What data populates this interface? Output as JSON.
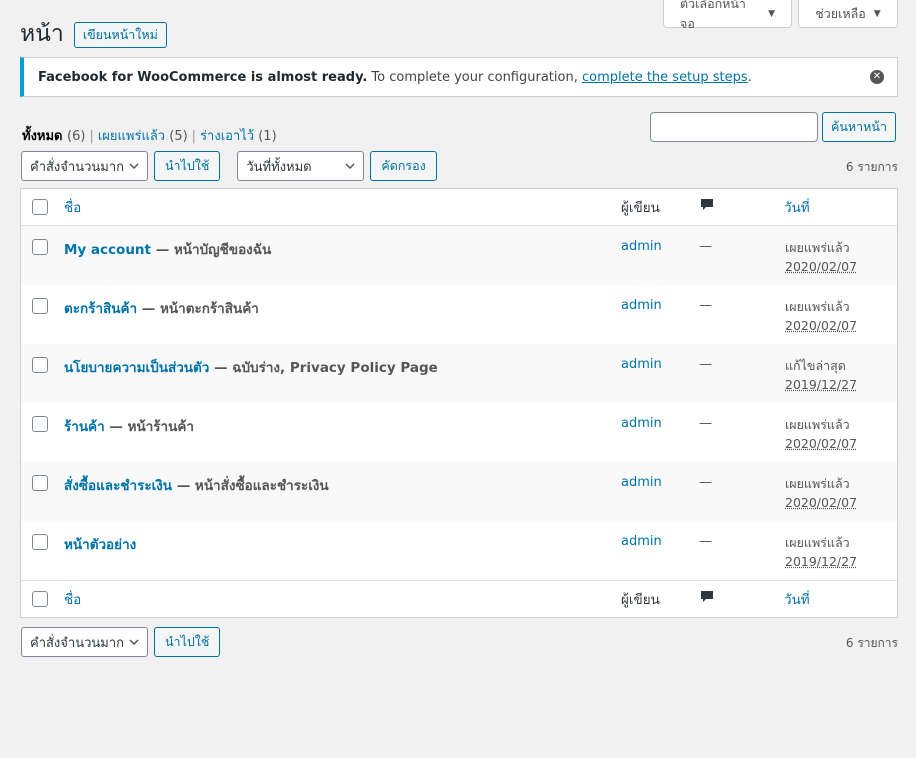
{
  "screen_options": {
    "label": "ตัวเลือกหน้าจอ"
  },
  "help": {
    "label": "ช่วยเหลือ"
  },
  "page": {
    "title": "หน้า",
    "add_new": "เขียนหน้าใหม่"
  },
  "notice": {
    "bold": "Facebook for WooCommerce is almost ready.",
    "text": " To complete your configuration, ",
    "link": "complete the setup steps",
    "end": "."
  },
  "views": [
    {
      "label": "ทั้งหมด",
      "count": "(6)"
    },
    {
      "label": "เผยแพร่แล้ว",
      "count": "(5)"
    },
    {
      "label": "ร่างเอาไว้",
      "count": "(1)"
    }
  ],
  "search": {
    "button": "ค้นหาหน้า",
    "value": ""
  },
  "bulk": {
    "selected": "คำสั่งจำนวนมาก",
    "apply": "นำไปใช้"
  },
  "dates": {
    "selected": "วันที่ทั้งหมด",
    "filter": "คัดกรอง"
  },
  "count_label": "6 รายการ",
  "columns": {
    "title": "ชื่อ",
    "author": "ผู้เขียน",
    "date": "วันที่"
  },
  "rows": [
    {
      "title": "My account",
      "state": " — หน้าบัญชีของฉัน",
      "author": "admin",
      "comments": "—",
      "status": "เผยแพร่แล้ว",
      "date": "2020/02/07"
    },
    {
      "title": "ตะกร้าสินค้า",
      "state": " — หน้าตะกร้าสินค้า",
      "author": "admin",
      "comments": "—",
      "status": "เผยแพร่แล้ว",
      "date": "2020/02/07"
    },
    {
      "title": "นโยบายความเป็นส่วนตัว",
      "state": " — ฉบับร่าง, Privacy Policy Page",
      "author": "admin",
      "comments": "—",
      "status": "แก้ไขล่าสุด",
      "date": "2019/12/27"
    },
    {
      "title": "ร้านค้า",
      "state": " — หน้าร้านค้า",
      "author": "admin",
      "comments": "—",
      "status": "เผยแพร่แล้ว",
      "date": "2020/02/07"
    },
    {
      "title": "สั่งซื้อและชำระเงิน",
      "state": " — หน้าสั่งซื้อและชำระเงิน",
      "author": "admin",
      "comments": "—",
      "status": "เผยแพร่แล้ว",
      "date": "2020/02/07"
    },
    {
      "title": "หน้าตัวอย่าง",
      "state": "",
      "author": "admin",
      "comments": "—",
      "status": "เผยแพร่แล้ว",
      "date": "2019/12/27"
    }
  ]
}
